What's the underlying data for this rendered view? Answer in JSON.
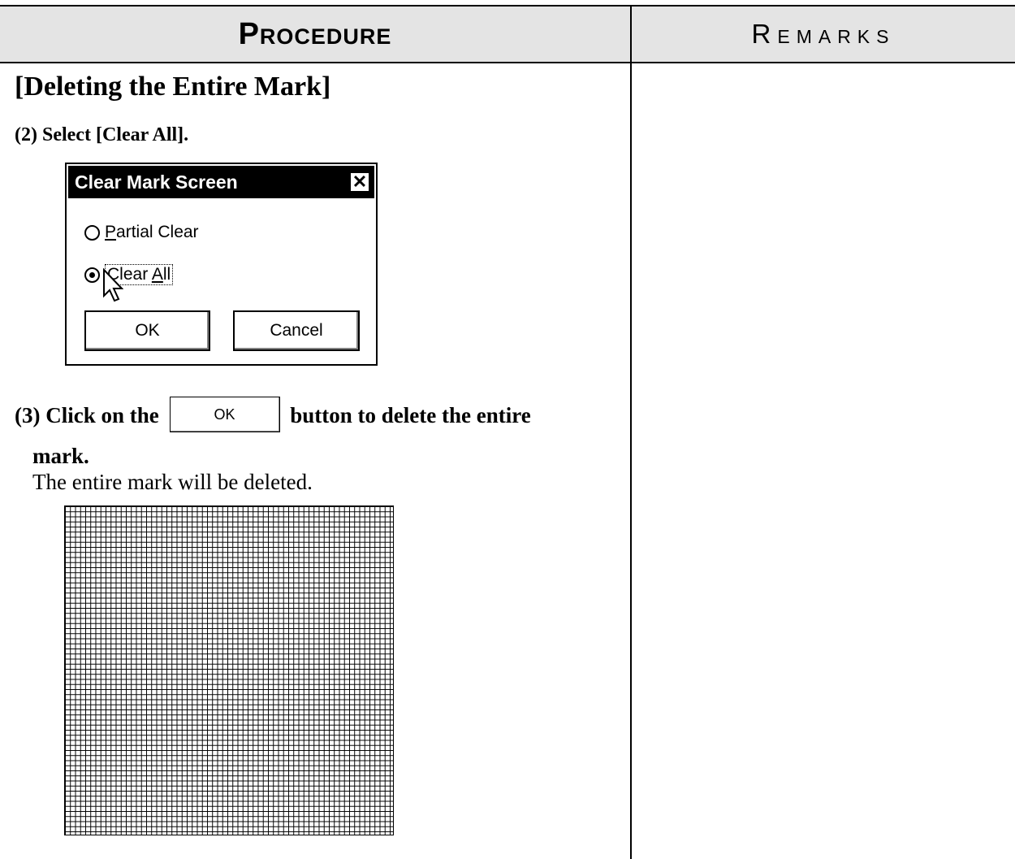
{
  "header": {
    "procedure": "Procedure",
    "remarks": "Remarks"
  },
  "section": {
    "title": "[Deleting the Entire Mark]"
  },
  "steps": {
    "step2": "(2) Select [Clear All].",
    "step3_before": "(3) Click on the",
    "step3_after": "button to delete the entire",
    "step3_line2": "mark.",
    "result": "The entire mark will be deleted.",
    "inline_ok_label": "OK"
  },
  "dialog": {
    "title": "Clear Mark Screen",
    "close_glyph": "✕",
    "options": [
      {
        "label": "Partial Clear",
        "mnemonic": "P",
        "rest": "artial Clear",
        "selected": false
      },
      {
        "label": "Clear All",
        "prefix": "Clear ",
        "mnemonic": "A",
        "rest": "ll",
        "selected": true
      }
    ],
    "ok_label": "OK",
    "cancel_label": "Cancel"
  }
}
